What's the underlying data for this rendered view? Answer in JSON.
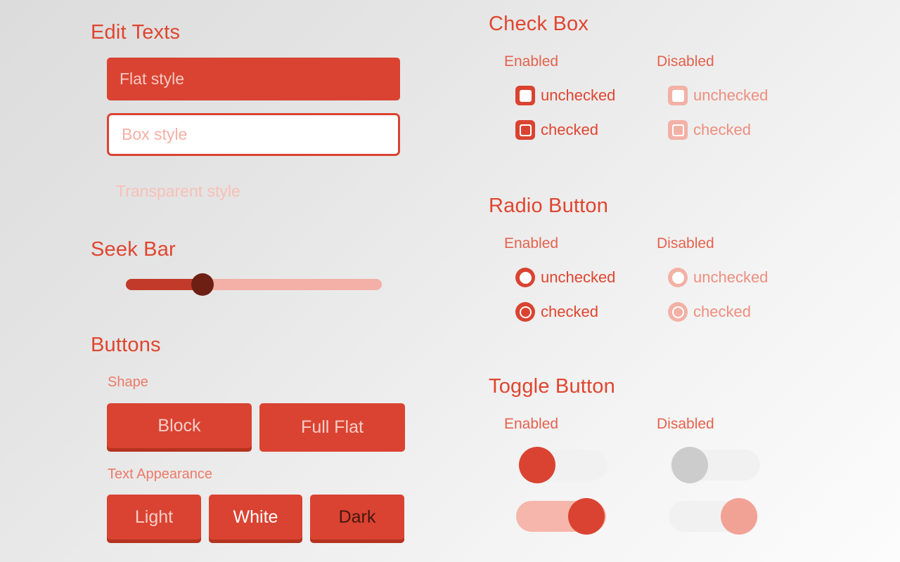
{
  "theme": {
    "accent": "#da4331",
    "accent_dark": "#b5331f",
    "accent_muted": "#f3b1a6",
    "seek_fill": "#c13a2a",
    "seek_thumb": "#6e1f13",
    "bg_from": "#dcdcdc",
    "bg_to": "#fcfcfc"
  },
  "edit_texts": {
    "title": "Edit Texts",
    "fields": [
      {
        "name": "flat",
        "value": "",
        "placeholder": "Flat style"
      },
      {
        "name": "box",
        "value": "",
        "placeholder": "Box style"
      },
      {
        "name": "transparent",
        "value": "",
        "placeholder": "Transparent style"
      }
    ]
  },
  "seek_bar": {
    "title": "Seek Bar",
    "value": 30,
    "min": 0,
    "max": 100
  },
  "buttons": {
    "title": "Buttons",
    "shape": {
      "label": "Shape",
      "items": [
        {
          "label": "Block",
          "style": "block"
        },
        {
          "label": "Full Flat",
          "style": "flat"
        }
      ]
    },
    "text_appearance": {
      "label": "Text Appearance",
      "items": [
        {
          "label": "Light",
          "style": "t-light"
        },
        {
          "label": "White",
          "style": "t-white"
        },
        {
          "label": "Dark",
          "style": "t-dark"
        }
      ]
    }
  },
  "check_box": {
    "title": "Check Box",
    "columns": [
      {
        "header": "Enabled",
        "items": [
          {
            "label": "unchecked",
            "checked": false
          },
          {
            "label": "checked",
            "checked": true
          }
        ]
      },
      {
        "header": "Disabled",
        "items": [
          {
            "label": "unchecked",
            "checked": false
          },
          {
            "label": "checked",
            "checked": true
          }
        ]
      }
    ]
  },
  "radio_button": {
    "title": "Radio Button",
    "columns": [
      {
        "header": "Enabled",
        "items": [
          {
            "label": "unchecked",
            "checked": false
          },
          {
            "label": "checked",
            "checked": true
          }
        ]
      },
      {
        "header": "Disabled",
        "items": [
          {
            "label": "unchecked",
            "checked": false
          },
          {
            "label": "checked",
            "checked": true
          }
        ]
      }
    ]
  },
  "toggle_button": {
    "title": "Toggle Button",
    "columns": [
      {
        "header": "Enabled",
        "items": [
          {
            "on": false,
            "knob": "red"
          },
          {
            "on": true,
            "knob": "red"
          }
        ]
      },
      {
        "header": "Disabled",
        "items": [
          {
            "on": false,
            "knob": "grey"
          },
          {
            "on": false,
            "knob": "pink"
          }
        ]
      }
    ]
  }
}
